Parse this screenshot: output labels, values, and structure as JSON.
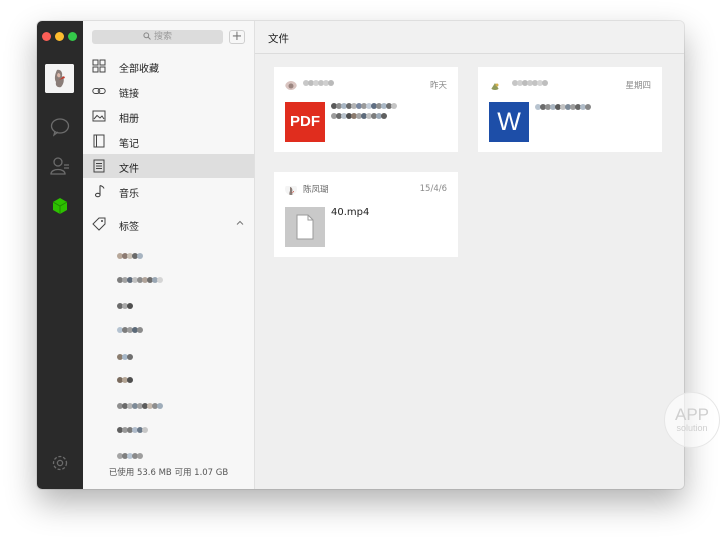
{
  "search": {
    "placeholder": "搜索"
  },
  "add_button": "+",
  "nav": {
    "all": "全部收藏",
    "links": "链接",
    "photos": "相册",
    "notes": "笔记",
    "files": "文件",
    "music": "音乐",
    "tags": "标签"
  },
  "storage": "已使用 53.6 MB 可用 1.07 GB",
  "main": {
    "title": "文件",
    "cards": [
      {
        "date": "昨天",
        "icon_text": "PDF",
        "icon": "pdf-icon"
      },
      {
        "date": "星期四",
        "icon_text": "W",
        "icon": "word-icon"
      },
      {
        "sender": "陈凤瑚",
        "date": "15/4/6",
        "filename": "40.mp4",
        "icon": "generic-file-icon"
      }
    ]
  },
  "watermark": {
    "line1": "APP",
    "line2": "solution"
  },
  "colors": {
    "rail": "#2a2a2a",
    "active_green": "#2dc100",
    "pdf_red": "#e02d1e",
    "word_blue": "#1d4ea8"
  }
}
